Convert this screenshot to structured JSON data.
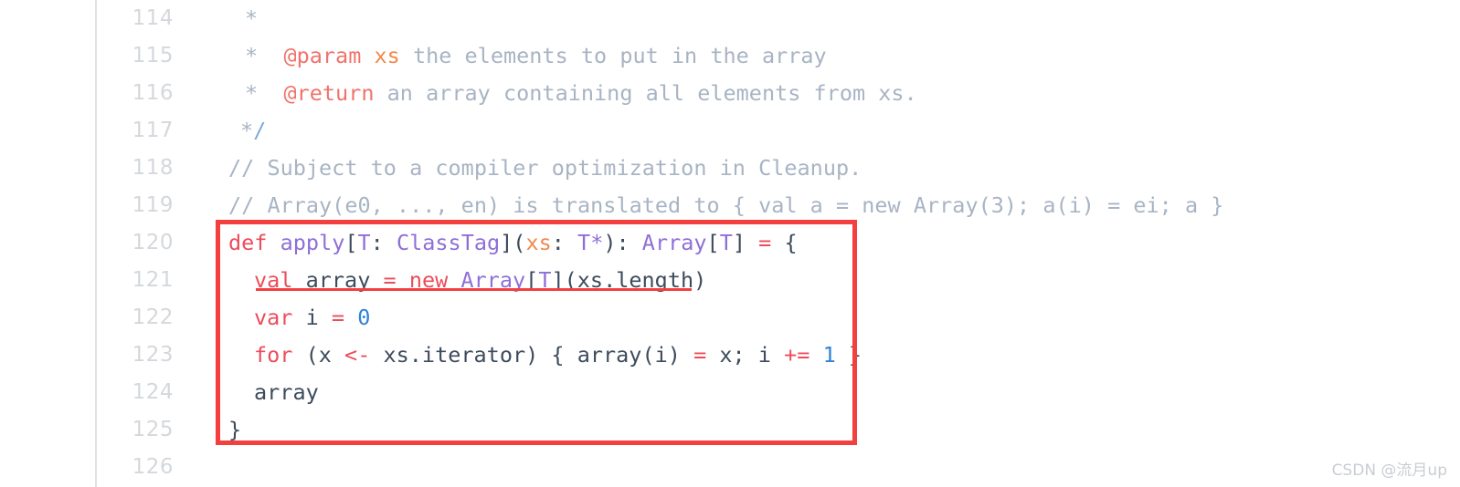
{
  "editor": {
    "first_line_number": 114,
    "gutter_divider_color": "#dfe2e5",
    "background_color": "#ffffff",
    "line_numbers": [
      "114",
      "115",
      "116",
      "117",
      "118",
      "119",
      "120",
      "121",
      "122",
      "123",
      "124",
      "125",
      "126"
    ]
  },
  "annotations": {
    "box_color": "#f43f3f",
    "underline_color": "#f43f3f",
    "box_covers_lines": "120-125",
    "underline_covers_line": "121"
  },
  "colors": {
    "comment": "#a8b4c4",
    "doc_tag": "#f0736c",
    "keyword": "#ec4c5a",
    "type": "#8e6fd8",
    "param": "#f08a4b",
    "number": "#2f82d6",
    "plain": "#3d4b5c",
    "line_number": "#d4d8dc",
    "annotation_red": "#f43f3f",
    "watermark": "#c9cdd2"
  },
  "watermark": {
    "text": "CSDN @流月up"
  },
  "lines": [
    {
      "number": "114",
      "indent": 18,
      "tokens": [
        {
          "text": "*",
          "kind": "comment"
        }
      ]
    },
    {
      "number": "115",
      "indent": 18,
      "tokens": [
        {
          "text": "*  ",
          "kind": "comment"
        },
        {
          "text": "@param",
          "kind": "doctag"
        },
        {
          "text": " ",
          "kind": "comment"
        },
        {
          "text": "xs",
          "kind": "docparam"
        },
        {
          "text": " the elements to put in the array",
          "kind": "comment"
        }
      ]
    },
    {
      "number": "116",
      "indent": 18,
      "tokens": [
        {
          "text": "*  ",
          "kind": "comment"
        },
        {
          "text": "@return",
          "kind": "doctag"
        },
        {
          "text": " an array containing all elements from xs.",
          "kind": "comment"
        }
      ]
    },
    {
      "number": "117",
      "indent": 13,
      "tokens": [
        {
          "text": "*",
          "kind": "comment"
        },
        {
          "text": "/",
          "kind": "slash"
        }
      ]
    },
    {
      "number": "118",
      "indent": 0,
      "tokens": [
        {
          "text": "// Subject to a compiler optimization in Cleanup.",
          "kind": "comment"
        }
      ]
    },
    {
      "number": "119",
      "indent": 0,
      "tokens": [
        {
          "text": "// Array(e0, ..., en) is translated to { val a = new Array(3); a(i) = ei; a }",
          "kind": "comment"
        }
      ]
    },
    {
      "number": "120",
      "indent": 0,
      "tokens": [
        {
          "text": "def",
          "kind": "keyword"
        },
        {
          "text": " ",
          "kind": "plain"
        },
        {
          "text": "apply",
          "kind": "type"
        },
        {
          "text": "[",
          "kind": "punct"
        },
        {
          "text": "T",
          "kind": "type"
        },
        {
          "text": ": ",
          "kind": "punct"
        },
        {
          "text": "ClassTag",
          "kind": "type"
        },
        {
          "text": "](",
          "kind": "punct"
        },
        {
          "text": "xs",
          "kind": "param"
        },
        {
          "text": ": ",
          "kind": "punct"
        },
        {
          "text": "T*",
          "kind": "type"
        },
        {
          "text": "): ",
          "kind": "punct"
        },
        {
          "text": "Array",
          "kind": "type"
        },
        {
          "text": "[",
          "kind": "punct"
        },
        {
          "text": "T",
          "kind": "type"
        },
        {
          "text": "] ",
          "kind": "punct"
        },
        {
          "text": "=",
          "kind": "op"
        },
        {
          "text": " {",
          "kind": "punct"
        }
      ]
    },
    {
      "number": "121",
      "indent": 28,
      "tokens": [
        {
          "text": "val",
          "kind": "keyword"
        },
        {
          "text": " array ",
          "kind": "plain"
        },
        {
          "text": "=",
          "kind": "op"
        },
        {
          "text": " ",
          "kind": "plain"
        },
        {
          "text": "new",
          "kind": "keyword"
        },
        {
          "text": " ",
          "kind": "plain"
        },
        {
          "text": "Array",
          "kind": "type"
        },
        {
          "text": "[",
          "kind": "punct"
        },
        {
          "text": "T",
          "kind": "type"
        },
        {
          "text": "](xs.length)",
          "kind": "punct"
        }
      ]
    },
    {
      "number": "122",
      "indent": 28,
      "tokens": [
        {
          "text": "var",
          "kind": "keyword"
        },
        {
          "text": " i ",
          "kind": "plain"
        },
        {
          "text": "=",
          "kind": "op"
        },
        {
          "text": " ",
          "kind": "plain"
        },
        {
          "text": "0",
          "kind": "number"
        }
      ]
    },
    {
      "number": "123",
      "indent": 28,
      "tokens": [
        {
          "text": "for",
          "kind": "keyword"
        },
        {
          "text": " (x ",
          "kind": "plain"
        },
        {
          "text": "<-",
          "kind": "op"
        },
        {
          "text": " xs.iterator) { array(i) ",
          "kind": "plain"
        },
        {
          "text": "=",
          "kind": "op"
        },
        {
          "text": " x; i ",
          "kind": "plain"
        },
        {
          "text": "+=",
          "kind": "op"
        },
        {
          "text": " ",
          "kind": "plain"
        },
        {
          "text": "1",
          "kind": "number"
        },
        {
          "text": " }",
          "kind": "plain"
        }
      ]
    },
    {
      "number": "124",
      "indent": 28,
      "tokens": [
        {
          "text": "array",
          "kind": "plain"
        }
      ]
    },
    {
      "number": "125",
      "indent": 0,
      "tokens": [
        {
          "text": "}",
          "kind": "plain"
        }
      ]
    },
    {
      "number": "126",
      "indent": 0,
      "tokens": []
    }
  ]
}
